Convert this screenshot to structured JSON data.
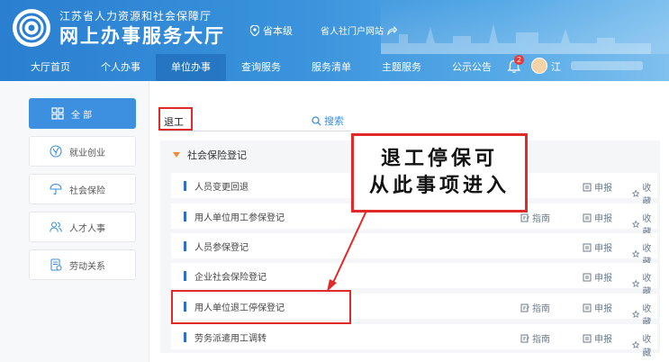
{
  "header": {
    "org_name": "江苏省人力资源和社会保障厅",
    "hall_name": "网上办事服务大厅",
    "level": "省本级",
    "portal_link": "省人社门户网站",
    "notification_count": "2",
    "user_name": "江",
    "colors": {
      "header_start": "#2a7fd0",
      "header_end": "#7fc0ee",
      "accent": "#3d8fe0",
      "highlight": "#e02a2a"
    }
  },
  "nav": {
    "items": [
      "大厅首页",
      "个人办事",
      "单位办事",
      "查询服务",
      "服务清单",
      "主题服务",
      "公示公告"
    ],
    "active_index": 2
  },
  "sidebar": {
    "items": [
      {
        "label": "全 部",
        "icon": "grid-icon"
      },
      {
        "label": "就业创业",
        "icon": "leaf-icon"
      },
      {
        "label": "社会保险",
        "icon": "umbrella-icon"
      },
      {
        "label": "人才人事",
        "icon": "people-icon"
      },
      {
        "label": "劳动关系",
        "icon": "document-icon"
      }
    ],
    "active_index": 0
  },
  "search": {
    "value": "退工",
    "button_label": "搜索"
  },
  "category": {
    "title": "社会保险登记"
  },
  "items": [
    {
      "name": "人员变更回退",
      "guide": "",
      "apply": "申报",
      "fav": "收藏"
    },
    {
      "name": "用人单位用工参保登记",
      "guide": "指南",
      "apply": "申报",
      "fav": "收藏"
    },
    {
      "name": "人员参保登记",
      "guide": "",
      "apply": "申报",
      "fav": "收藏"
    },
    {
      "name": "企业社会保险登记",
      "guide": "",
      "apply": "申报",
      "fav": "收藏"
    },
    {
      "name": "用人单位退工停保登记",
      "guide": "指南",
      "apply": "申报",
      "fav": "收藏"
    },
    {
      "name": "劳务派遣用工调转",
      "guide": "指南",
      "apply": "申报",
      "fav": "收藏"
    }
  ],
  "annotation": {
    "line1": "退工停保可",
    "line2": "从此事项进入"
  }
}
